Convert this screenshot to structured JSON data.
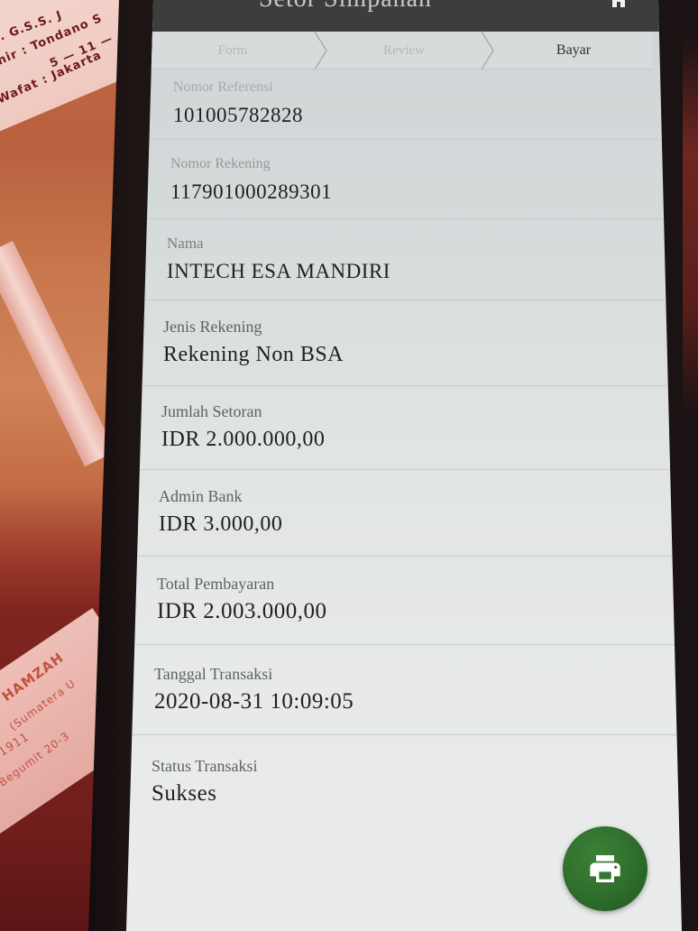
{
  "app": {
    "title": "Setor Simpanan",
    "home_icon": "home-icon"
  },
  "stepper": {
    "steps": [
      "Form",
      "Review",
      "Bayar"
    ],
    "active_step": 2,
    "separator_icon": "chevron-right-icon"
  },
  "details": [
    {
      "label": "Nomor Referensi",
      "value": "101005782828"
    },
    {
      "label": "Nomor Rekening",
      "value": "117901000289301"
    },
    {
      "label": "Nama",
      "value": "INTECH ESA MANDIRI"
    },
    {
      "label": "Jenis Rekening",
      "value": "Rekening Non BSA"
    },
    {
      "label": "Jumlah Setoran",
      "value": "IDR 2.000.000,00"
    },
    {
      "label": "Admin Bank",
      "value": "IDR 3.000,00"
    },
    {
      "label": "Total Pembayaran",
      "value": "IDR 2.003.000,00"
    },
    {
      "label": "Tanggal Transaksi",
      "value": "2020-08-31 10:09:05"
    },
    {
      "label": "Status Transaksi",
      "value": "Sukses"
    }
  ],
  "print_button": {
    "icon": "printer-icon"
  },
  "colors": {
    "accent": "#2d6b2a",
    "app_bar": "#3c3d3d",
    "stepper_bg": "#d7dbdb",
    "step_inactive": "#b3b8b8",
    "step_active": "#2f3030",
    "label": "#5f6262",
    "value": "#1f2020"
  },
  "background_photo": {
    "top_card_lines": [
      ". G.S.S. J",
      "nir : Tondano S",
      "5 — 11 —",
      "Wafat : Jakarta"
    ],
    "bottom_card_lines": [
      "HAMZAH",
      "(Sumatera U",
      "1911",
      "Begumit 20-3"
    ]
  }
}
